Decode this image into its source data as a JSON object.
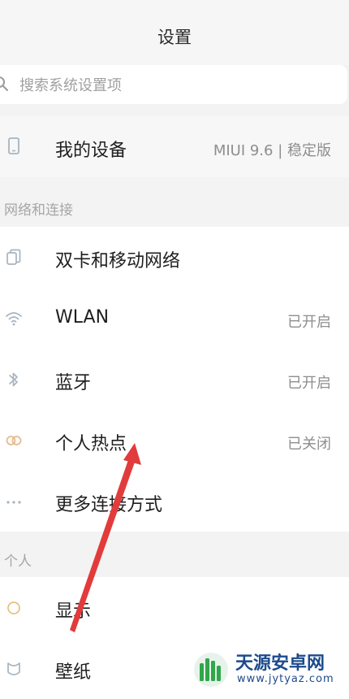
{
  "header": {
    "title": "设置"
  },
  "search": {
    "placeholder": "搜索系统设置项"
  },
  "device": {
    "label": "我的设备",
    "value": "MIUI 9.6 | 稳定版"
  },
  "sections": {
    "network": "网络和连接",
    "personal": "个人"
  },
  "network_items": [
    {
      "label": "双卡和移动网络",
      "value": "",
      "icon": "dual-sim-icon"
    },
    {
      "label": "WLAN",
      "value": "已开启",
      "icon": "wifi-icon"
    },
    {
      "label": "蓝牙",
      "value": "已开启",
      "icon": "bluetooth-icon"
    },
    {
      "label": "个人热点",
      "value": "已关闭",
      "icon": "hotspot-icon"
    },
    {
      "label": "更多连接方式",
      "value": "",
      "icon": "more-icon"
    }
  ],
  "personal_items": [
    {
      "label": "显示",
      "icon": "display-icon"
    },
    {
      "label": "壁纸",
      "icon": "wallpaper-icon"
    }
  ],
  "annotation": {
    "color": "#e23b3b"
  },
  "watermark": {
    "title": "天源安卓网",
    "subtitle": "www.jytyaz.com",
    "logo_color": "#2fa74a",
    "text_color": "#1c4b8c"
  }
}
